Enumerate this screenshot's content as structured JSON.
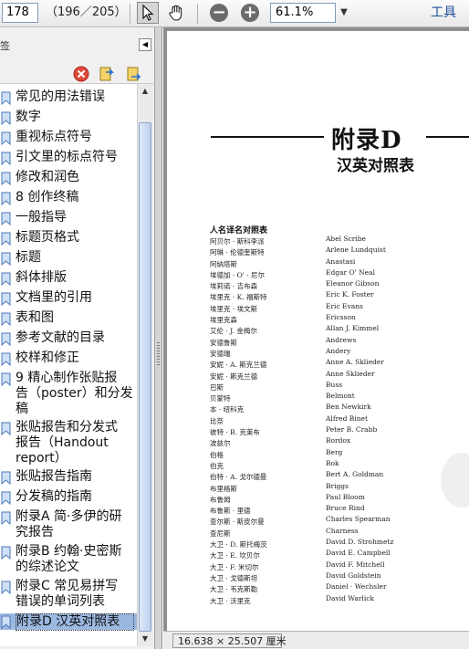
{
  "toolbar": {
    "page_input_value": "178",
    "page_count": "（196／205）",
    "zoom_value": "61.1%",
    "tools_label": "工具"
  },
  "bookmarks_panel": {
    "title": "签",
    "items": [
      {
        "label": "常见的用法错误"
      },
      {
        "label": "数字"
      },
      {
        "label": "重视标点符号"
      },
      {
        "label": "引文里的标点符号"
      },
      {
        "label": "修改和润色"
      },
      {
        "label": "8  创作终稿"
      },
      {
        "label": "一般指导"
      },
      {
        "label": "标题页格式"
      },
      {
        "label": "标题"
      },
      {
        "label": "斜体排版"
      },
      {
        "label": "文档里的引用"
      },
      {
        "label": "表和图"
      },
      {
        "label": "参考文献的目录"
      },
      {
        "label": "校样和修正"
      },
      {
        "label": "9  精心制作张贴报\n告（poster）和分发\n稿"
      },
      {
        "label": "张贴报告和分发式\n报告（Handout\nreport）"
      },
      {
        "label": "张贴报告指南"
      },
      {
        "label": "分发稿的指南"
      },
      {
        "label": "附录A  简·多伊的研\n究报告"
      },
      {
        "label": "附录B  约翰·史密斯\n的综述论文"
      },
      {
        "label": "附录C  常见易拼写\n错误的单词列表"
      },
      {
        "label": "附录D  汉英对照表",
        "selected": true
      }
    ]
  },
  "document": {
    "appendix_title": "附录D",
    "subtitle": "汉英对照表",
    "section_heading": "人名译名对照表",
    "names_cn": [
      "阿贝尔 · 斯科李派",
      "阿琳 · 伦德奎斯特",
      "阿纳塔斯",
      "埃德加 · O' · 尼尔",
      "埃莉诺 · 吉布森",
      "埃里克 · K. 福斯特",
      "埃里克 · 埃文斯",
      "埃里克森",
      "艾伦 · J. 金梅尔",
      "安德鲁斯",
      "安德瑞",
      "安妮 · A. 斯克兰德",
      "安妮 · 斯克兰德",
      "巴斯",
      "贝蒙特",
      "本 · 纽科克",
      "比奈",
      "彼特 · B. 克莱布",
      "波兹尔",
      "伯格",
      "伯克",
      "伯特 · A. 戈尔德曼",
      "布里格斯",
      "布鲁姆",
      "布鲁斯 · 里德",
      "查尔斯 · 斯皮尔曼",
      "查尼斯",
      "大卫 · D. 斯托梅茨",
      "大卫 · E. 坎贝尔",
      "大卫 · F. 米切尔",
      "大卫 · 戈德斯坦",
      "大卫 · 韦克斯勒",
      "大卫 · 沃里克"
    ],
    "names_en": [
      "Abel Scribe",
      "Arlene Lundquist",
      "Anastasi",
      "Edgar O'  Neal",
      "Eleanor Gibson",
      "Eric K. Foster",
      "Eric Evans",
      "Ericsson",
      "Allan J. Kimmel",
      "Andrews",
      "Andery",
      "Anne A. Sklieder",
      "Anne Sklieder",
      "Buss",
      "Belmont",
      "Ben Newkirk",
      "Alfred Binet",
      "Peter B. Crabb",
      "Bordox",
      "Berg",
      "Bok",
      "Bert A. Goldman",
      "Briggs",
      "Paul Bloom",
      "Bruce Rind",
      "Charles Spearman",
      "Charness",
      "David D. Strohmetz",
      "David E. Campbell",
      "David F. Mitchell",
      "David Goldstein",
      "Daniel · Wechsler",
      "David Warlick"
    ]
  },
  "status_bar": {
    "page_dimensions": "16.638 × 25.507 厘米"
  }
}
